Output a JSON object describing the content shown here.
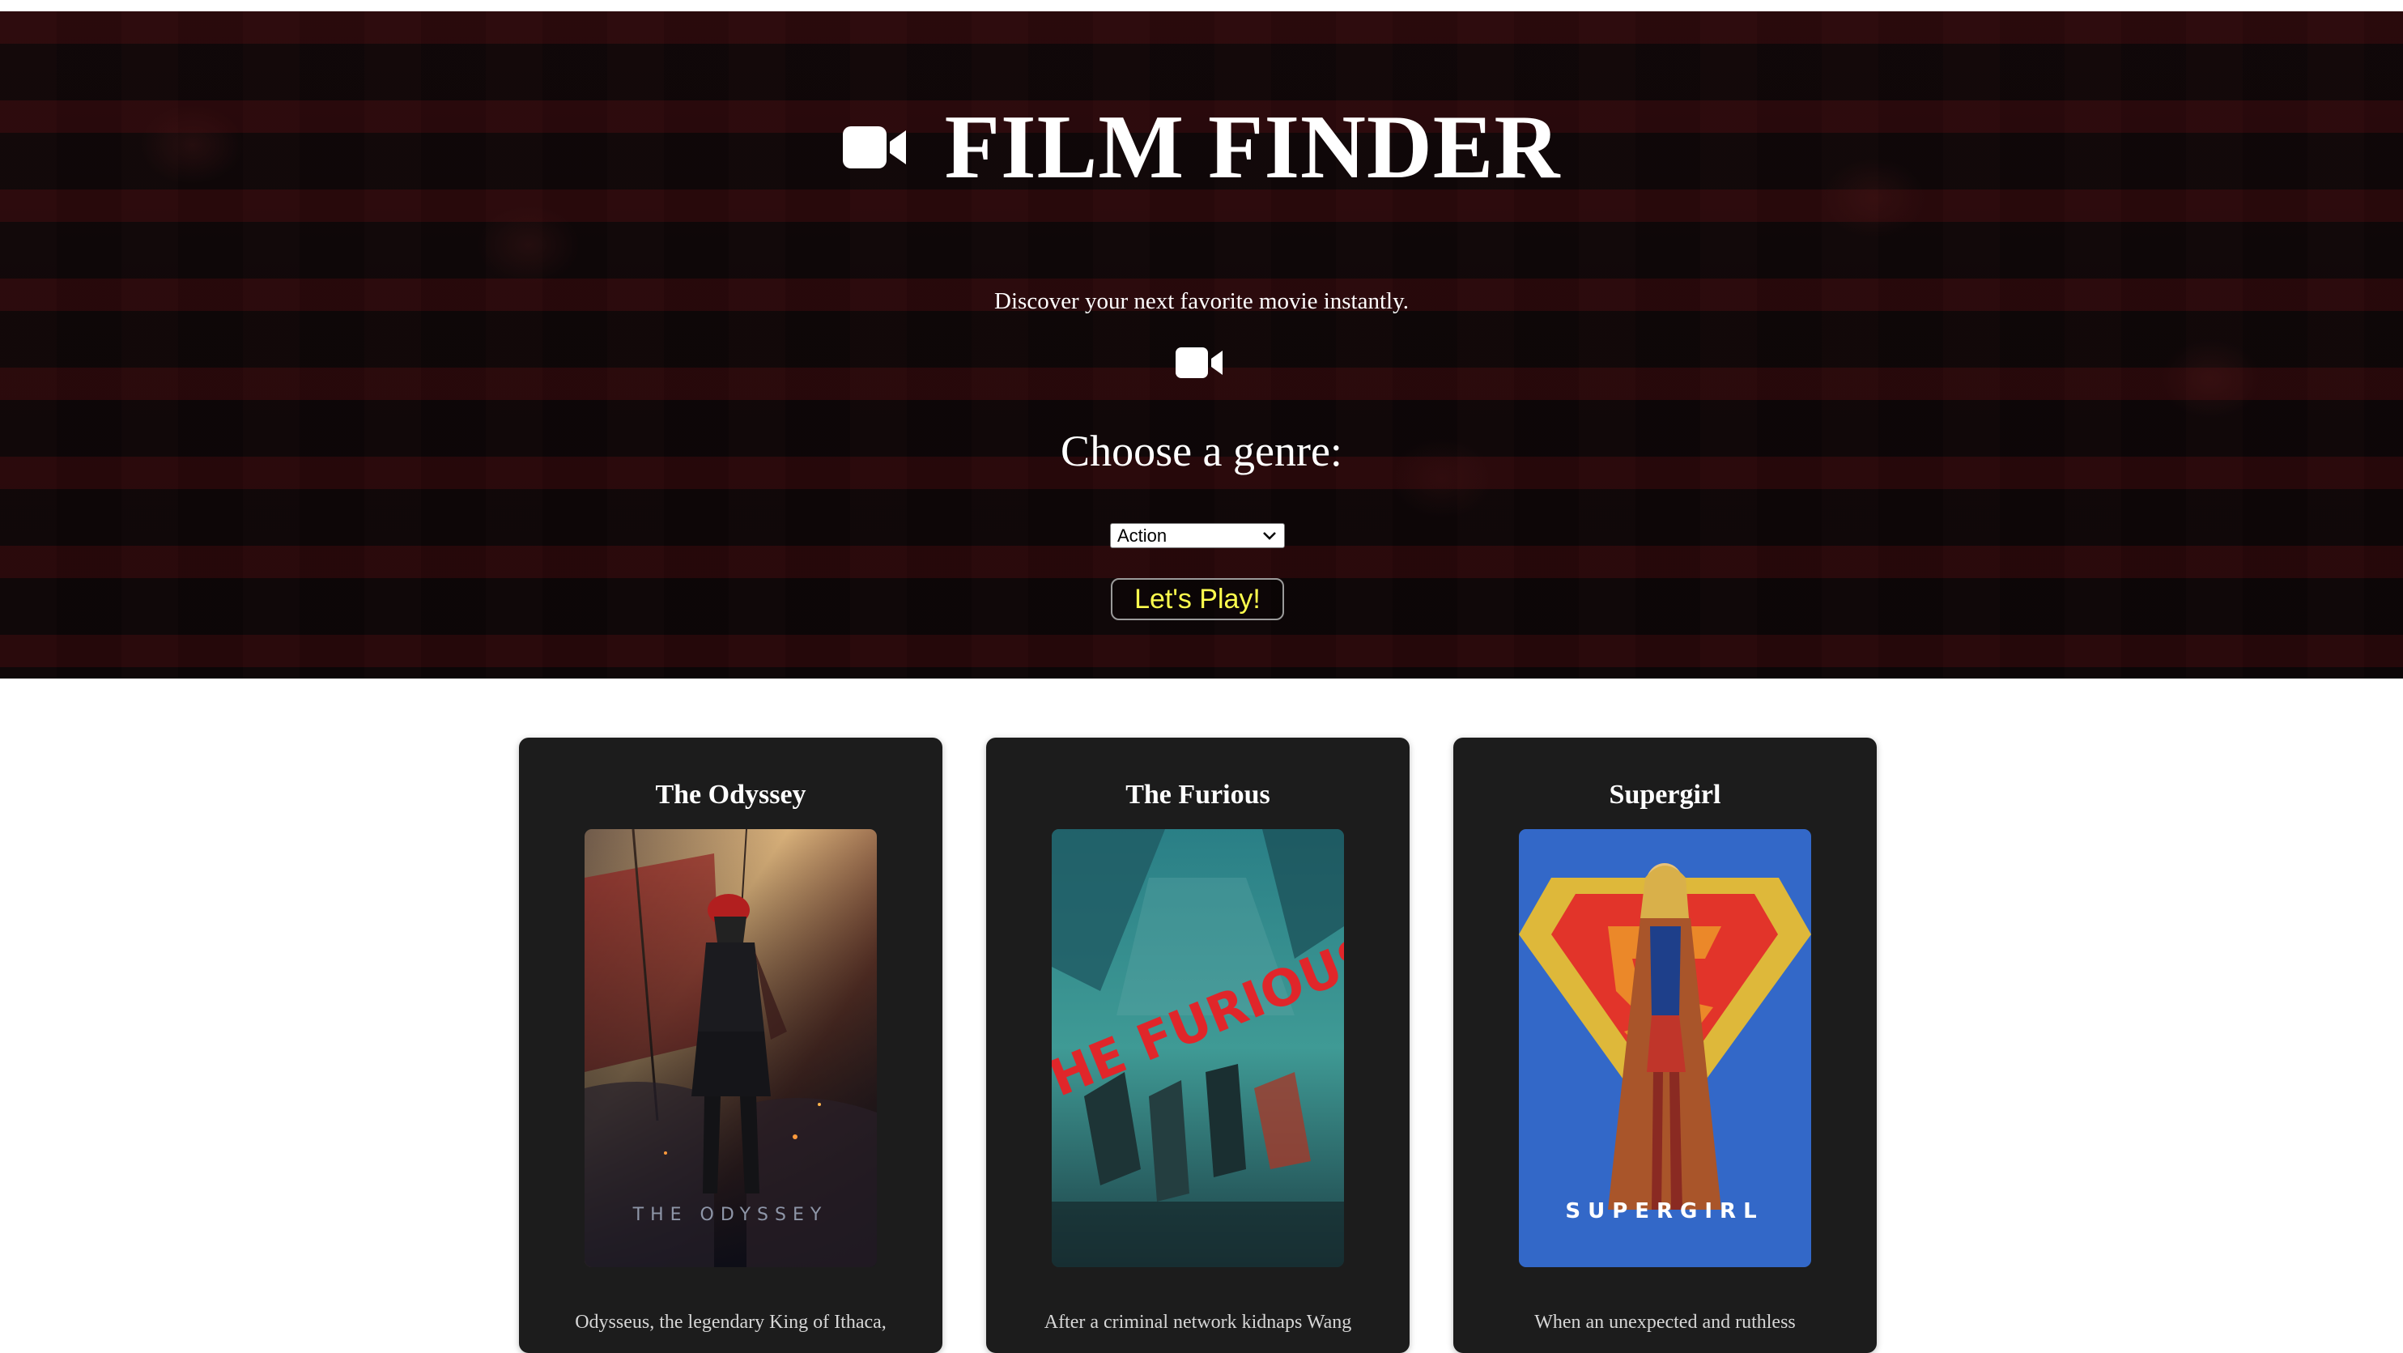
{
  "hero": {
    "title": "FILM FINDER",
    "tagline": "Discover your next favorite movie instantly.",
    "title_icon": "video-camera-icon",
    "secondary_icon": "video-camera-icon"
  },
  "genre": {
    "label": "Choose a genre:",
    "selected": "Action"
  },
  "play_button": {
    "label": "Let's Play!",
    "text_color": "#ffff4d"
  },
  "movies": [
    {
      "title": "The Odyssey",
      "poster_text": "THE ODYSSEY",
      "description": "Odysseus, the legendary King of Ithaca,"
    },
    {
      "title": "The Furious",
      "poster_text": "THE FURIOUS",
      "description": "After a criminal network kidnaps Wang"
    },
    {
      "title": "Supergirl",
      "poster_text": "SUPERGIRL",
      "description": "When an unexpected and ruthless"
    }
  ],
  "colors": {
    "card_background": "#1c1c1c",
    "page_background": "#ffffff",
    "hero_text": "#ffffff"
  }
}
